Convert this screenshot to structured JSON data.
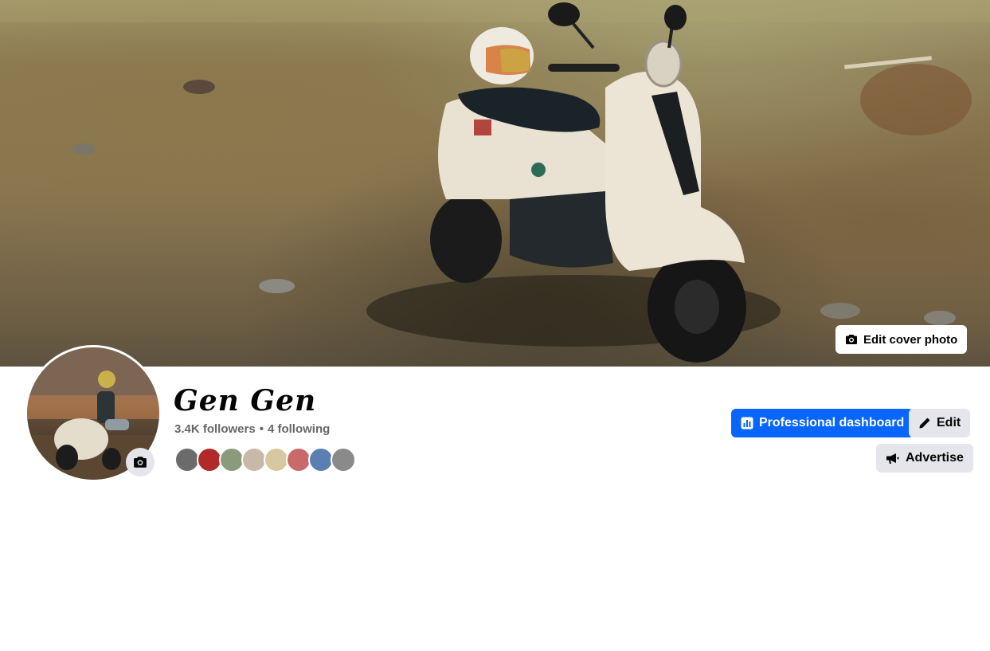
{
  "cover": {
    "edit_label": "Edit cover photo",
    "icon": "camera-icon"
  },
  "profile": {
    "name": "Gen Gen",
    "followers": "3.4K followers",
    "separator": "•",
    "following": "4 following",
    "avatar_camera_icon": "camera-icon"
  },
  "friends": {
    "count_shown": 8,
    "colors": [
      "#6b6b6b",
      "#b02a2a",
      "#8a9a7a",
      "#c7b8a8",
      "#d8c8a0",
      "#c86a6a",
      "#5a7fb0",
      "#8a8a8a"
    ]
  },
  "actions": {
    "dashboard_label": "Professional dashboard",
    "dashboard_icon": "chart-icon",
    "edit_label": "Edit",
    "edit_icon": "pencil-icon",
    "advertise_label": "Advertise",
    "advertise_icon": "megaphone-icon"
  },
  "colors": {
    "primary": "#0866ff",
    "secondary_button": "#e4e6eb",
    "text": "#050505",
    "muted_text": "#65676b"
  }
}
